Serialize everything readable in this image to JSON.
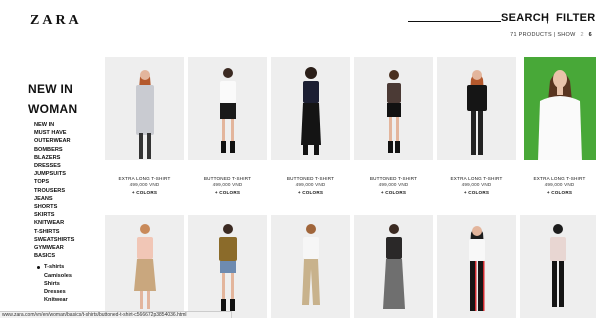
{
  "header": {
    "logo": "ZARA",
    "search_label": "SEARCH",
    "separator": "|",
    "filter_label": "FILTER"
  },
  "meta": {
    "products": "71 PRODUCTS",
    "separator": "|",
    "show_label": "SHOW",
    "options": [
      "2",
      "6"
    ],
    "active_option": "6"
  },
  "sidebar": {
    "title_line1": "NEW IN",
    "title_line2": "WOMAN",
    "items": [
      "NEW IN",
      "MUST HAVE",
      "OUTERWEAR",
      "BOMBERS",
      "BLAZERS",
      "DRESSES",
      "JUMPSUITS",
      "TOPS",
      "TROUSERS",
      "JEANS",
      "SHORTS",
      "SKIRTS",
      "KNITWEAR",
      "T-SHIRTS",
      "SWEATSHIRTS",
      "GYMWEAR",
      "BASICS"
    ],
    "sub_heading": "T-shirts",
    "sub_items": [
      "Camisoles",
      "Shirts",
      "Dresses",
      "Knitwear"
    ]
  },
  "products": [
    {
      "name": "EXTRA LONG T-SHIRT",
      "price": "499,000 VND",
      "colors": "+ COLORS"
    },
    {
      "name": "BUTTONED T-SHIRT",
      "price": "499,000 VND",
      "colors": "+ COLORS"
    },
    {
      "name": "BUTTONED T-SHIRT",
      "price": "499,000 VND",
      "colors": "+ COLORS"
    },
    {
      "name": "BUTTONED T-SHIRT",
      "price": "499,000 VND",
      "colors": "+ COLORS"
    },
    {
      "name": "EXTRA LONG T-SHIRT",
      "price": "499,000 VND",
      "colors": "+ COLORS"
    },
    {
      "name": "EXTRA LONG T-SHIRT",
      "price": "499,000 VND",
      "colors": "+ COLORS"
    }
  ],
  "status_bar": {
    "url": "www.zara.com/vn/en/woman/basics/t-shirts/buttoned-t-shirt-c566672p3854036.html"
  },
  "colors": {
    "background": "#ffffff",
    "tile_background": "#eeeeee",
    "green_tile": "#48a838",
    "text": "#111111"
  }
}
